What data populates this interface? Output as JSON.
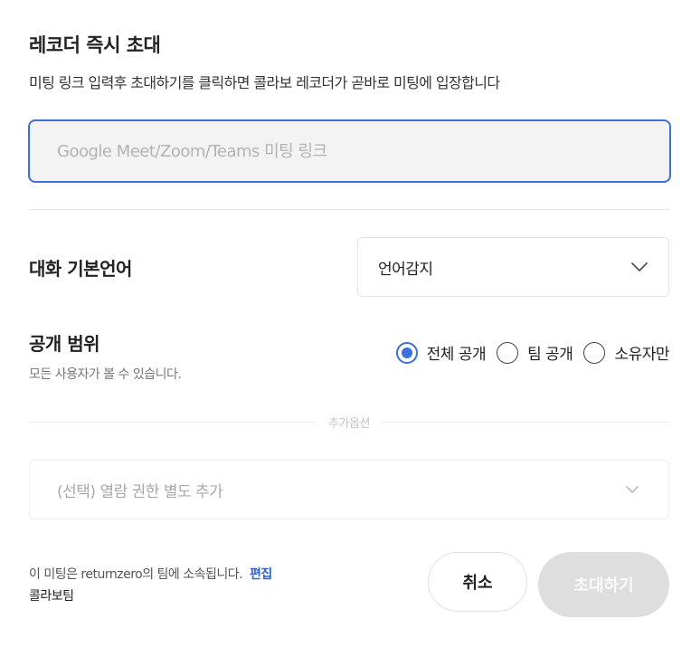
{
  "dialog": {
    "title": "레코더 즉시 초대",
    "subtitle": "미팅 링크 입력후 초대하기를 클릭하면 콜라보 레코더가 곧바로 미팅에 입장합니다"
  },
  "meeting_link": {
    "value": "",
    "placeholder": "Google Meet/Zoom/Teams 미팅 링크"
  },
  "language": {
    "label": "대화 기본언어",
    "selected": "언어감지",
    "icon": "chevron-down-icon"
  },
  "visibility": {
    "label": "공개 범위",
    "description": "모든 사용자가 볼 수 있습니다.",
    "options": [
      {
        "label": "전체 공개",
        "selected": true
      },
      {
        "label": "팀 공개",
        "selected": false
      },
      {
        "label": "소유자만",
        "selected": false
      }
    ]
  },
  "additional": {
    "divider_label": "추가옵션",
    "permission_placeholder": "(선택) 열람 권한 별도 추가"
  },
  "team": {
    "note": "이 미팅은 returnzero의 팀에 소속됩니다.",
    "edit_label": "편집",
    "name": "콜라보팀"
  },
  "actions": {
    "cancel_label": "취소",
    "invite_label": "초대하기"
  },
  "colors": {
    "accent": "#3d6fe0",
    "link": "#2f62d8",
    "disabled_button": "#dedede"
  }
}
